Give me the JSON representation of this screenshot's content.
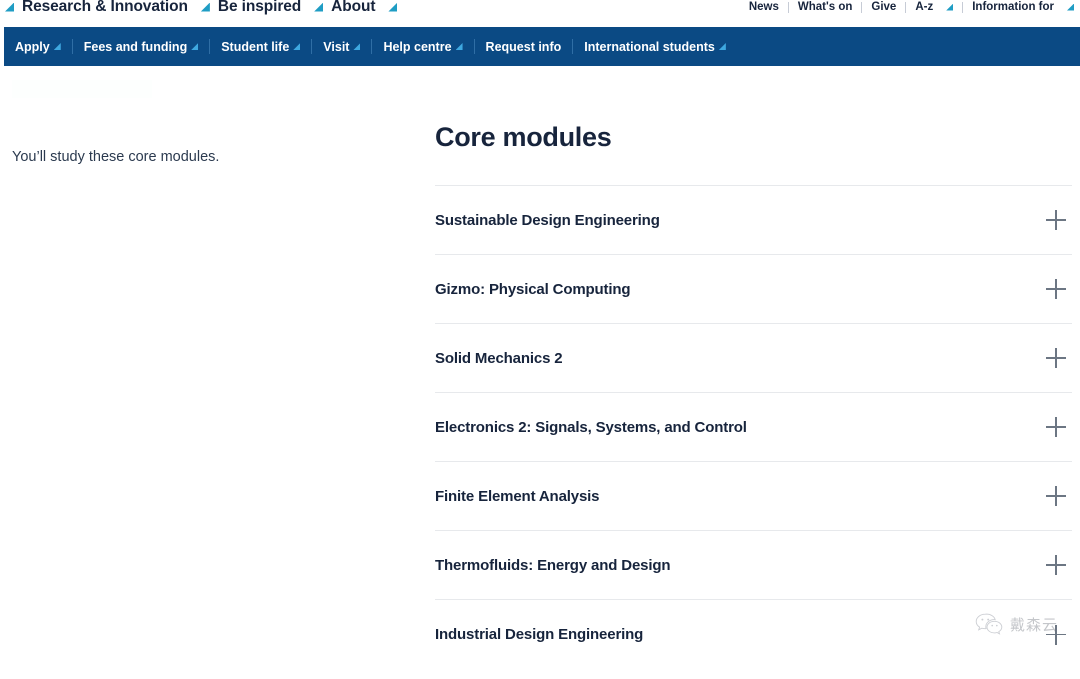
{
  "topnav": {
    "primary_items": [
      {
        "label": "Research & Innovation",
        "has_dropdown": true,
        "icon": "triangle-dropdown-icon"
      },
      {
        "label": "Be inspired",
        "has_dropdown": true,
        "icon": "triangle-dropdown-icon"
      },
      {
        "label": "About",
        "has_dropdown": true,
        "icon": "triangle-dropdown-icon"
      }
    ],
    "utility_items": [
      {
        "label": "News",
        "has_dropdown": false
      },
      {
        "label": "What's on",
        "has_dropdown": false
      },
      {
        "label": "Give",
        "has_dropdown": false
      },
      {
        "label": "A-z",
        "has_dropdown": true,
        "icon": "triangle-dropdown-icon"
      },
      {
        "label": "Information for",
        "has_dropdown": true,
        "icon": "triangle-dropdown-icon"
      }
    ]
  },
  "bluenav": {
    "background": "#0b4a84",
    "items": [
      {
        "label": "Apply",
        "has_dropdown": true,
        "icon": "triangle-dropdown-icon"
      },
      {
        "label": "Fees and funding",
        "has_dropdown": true,
        "icon": "triangle-dropdown-icon"
      },
      {
        "label": "Student life",
        "has_dropdown": true,
        "icon": "triangle-dropdown-icon"
      },
      {
        "label": "Visit",
        "has_dropdown": true,
        "icon": "triangle-dropdown-icon"
      },
      {
        "label": "Help centre",
        "has_dropdown": true,
        "icon": "triangle-dropdown-icon"
      },
      {
        "label": "Request info",
        "has_dropdown": false
      },
      {
        "label": "International students",
        "has_dropdown": true,
        "icon": "triangle-dropdown-icon"
      }
    ]
  },
  "main": {
    "intro_text": "You’ll study these core modules.",
    "heading": "Core modules",
    "accent_color": "#17243c",
    "modules": [
      {
        "title": "Sustainable Design Engineering",
        "expand_icon": "plus-icon"
      },
      {
        "title": "Gizmo: Physical Computing",
        "expand_icon": "plus-icon"
      },
      {
        "title": "Solid Mechanics 2",
        "expand_icon": "plus-icon"
      },
      {
        "title": "Electronics 2: Signals, Systems, and Control",
        "expand_icon": "plus-icon"
      },
      {
        "title": "Finite Element Analysis",
        "expand_icon": "plus-icon"
      },
      {
        "title": "Thermofluids: Energy and Design",
        "expand_icon": "plus-icon"
      },
      {
        "title": "Industrial Design Engineering",
        "expand_icon": "plus-icon"
      }
    ]
  },
  "watermark": {
    "text": "戴森云",
    "icon": "wechat-icon"
  }
}
